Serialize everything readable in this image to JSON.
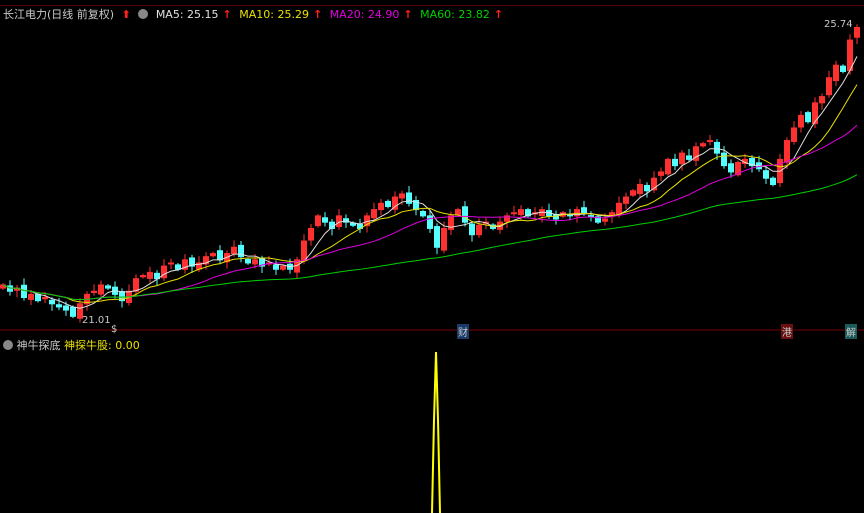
{
  "header": {
    "title": "长江电力(日线 前复权)",
    "ma5": "MA5: 25.15",
    "ma10": "MA10: 25.29",
    "ma20": "MA20: 24.90",
    "ma60": "MA60: 23.82",
    "up_arrow": "↑"
  },
  "price_labels": {
    "high": "25.74",
    "low": "21.01"
  },
  "event_tags": [
    {
      "text": "$",
      "color": "#ff3030"
    },
    {
      "text": "财",
      "color": "#3a8fd0"
    },
    {
      "text": "港",
      "color": "#ff3030"
    },
    {
      "text": "解",
      "color": "#40c0c0"
    }
  ],
  "indicator": {
    "name": "神牛探底",
    "series_label": "神探牛股: 0.00"
  },
  "colors": {
    "up": "#ff3030",
    "down": "#54ffff",
    "ma5": "#e0e0e0",
    "ma10": "#e8e000",
    "ma20": "#e000e0",
    "ma60": "#00d000",
    "indicator": "#ffff00"
  },
  "chart_data": {
    "type": "candlestick",
    "price_range": [
      21.01,
      25.74
    ],
    "closes": [
      21.6,
      21.5,
      21.55,
      21.4,
      21.45,
      21.35,
      21.4,
      21.3,
      21.25,
      21.2,
      21.1,
      21.3,
      21.45,
      21.5,
      21.6,
      21.55,
      21.45,
      21.35,
      21.5,
      21.7,
      21.75,
      21.8,
      21.7,
      21.9,
      21.95,
      21.85,
      22.0,
      21.9,
      21.95,
      22.05,
      22.1,
      22.0,
      22.1,
      22.2,
      22.05,
      21.95,
      22.0,
      21.9,
      21.95,
      21.85,
      21.9,
      21.85,
      22.0,
      22.3,
      22.5,
      22.7,
      22.6,
      22.5,
      22.7,
      22.6,
      22.55,
      22.5,
      22.7,
      22.8,
      22.9,
      22.85,
      23.0,
      23.05,
      22.9,
      22.8,
      22.7,
      22.5,
      22.2,
      22.5,
      22.7,
      22.8,
      22.6,
      22.4,
      22.55,
      22.6,
      22.5,
      22.6,
      22.7,
      22.75,
      22.8,
      22.7,
      22.75,
      22.8,
      22.7,
      22.65,
      22.75,
      22.7,
      22.8,
      22.75,
      22.7,
      22.6,
      22.65,
      22.75,
      22.9,
      23.0,
      23.1,
      23.2,
      23.1,
      23.3,
      23.4,
      23.6,
      23.5,
      23.7,
      23.6,
      23.8,
      23.85,
      23.9,
      23.7,
      23.5,
      23.4,
      23.55,
      23.6,
      23.5,
      23.45,
      23.3,
      23.2,
      23.6,
      23.9,
      24.1,
      24.3,
      24.2,
      24.5,
      24.6,
      24.9,
      25.1,
      25.0,
      25.5,
      25.7
    ],
    "indicator_spike_index": 62,
    "indicator_spike_value": 1
  }
}
